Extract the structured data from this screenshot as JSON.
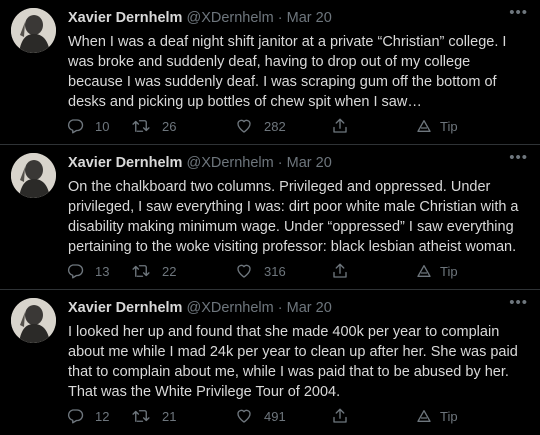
{
  "tweets": [
    {
      "name": "Xavier Dernhelm",
      "handle": "@XDernhelm",
      "separator": "·",
      "date": "Mar 20",
      "text": "When I was a deaf night shift janitor at a private “Christian” college. I was broke and suddenly deaf, having to drop out of my college because I was suddenly deaf.  I was scraping gum off the bottom of desks and picking up bottles of chew spit when I saw…",
      "replies": "10",
      "retweets": "26",
      "likes": "282",
      "tip_label": "Tip"
    },
    {
      "name": "Xavier Dernhelm",
      "handle": "@XDernhelm",
      "separator": "·",
      "date": "Mar 20",
      "text": "On the chalkboard two columns. Privileged and oppressed. Under privileged, I saw everything I was: dirt poor white male Christian with a disability making minimum wage. Under “oppressed” I saw everything pertaining to the woke visiting professor: black lesbian atheist woman.",
      "replies": "13",
      "retweets": "22",
      "likes": "316",
      "tip_label": "Tip"
    },
    {
      "name": "Xavier Dernhelm",
      "handle": "@XDernhelm",
      "separator": "·",
      "date": "Mar 20",
      "text": "I looked her up and found that she made 400k per year to complain about me while I mad 24k per year to clean up after her. She was paid that to complain about me, while I was paid that to be abused by her. That was the White Privilege Tour of 2004.",
      "replies": "12",
      "retweets": "21",
      "likes": "491",
      "tip_label": "Tip"
    }
  ],
  "more_icon": "ellipsis-icon",
  "colors": {
    "background": "#000000",
    "text": "#d9d9d9",
    "muted": "#6e767d",
    "divider": "#2f3336"
  }
}
